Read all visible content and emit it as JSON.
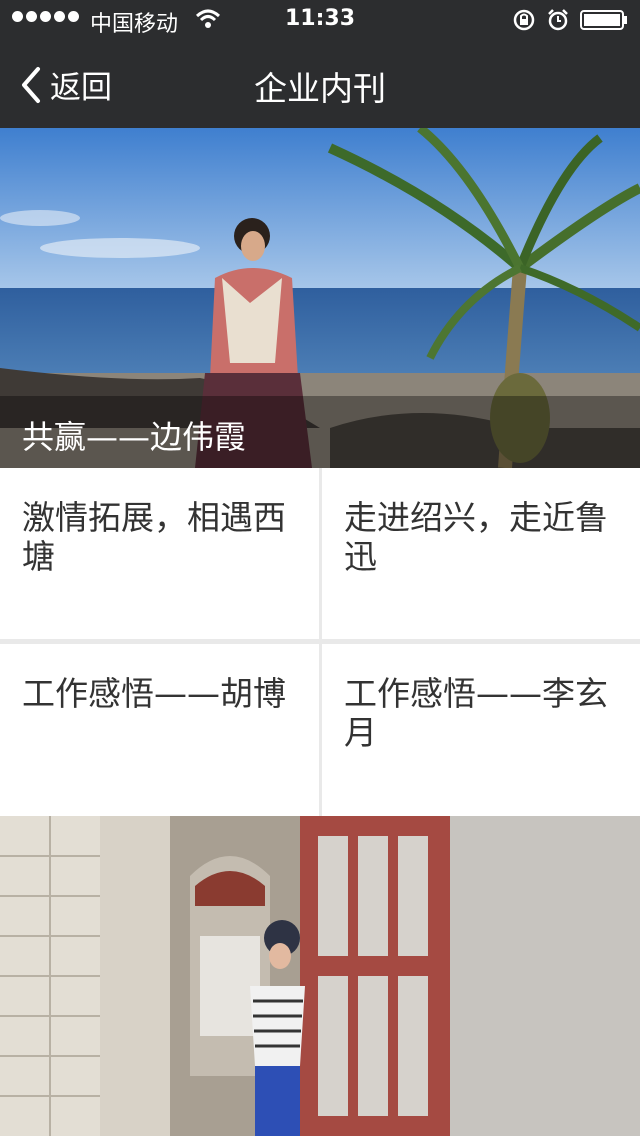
{
  "status_bar": {
    "carrier": "中国移动",
    "time": "11:33"
  },
  "nav": {
    "back_label": "返回",
    "title": "企业内刊"
  },
  "hero": {
    "caption": "共赢——边伟霞"
  },
  "tiles": [
    {
      "label": "激情拓展，相遇西塘"
    },
    {
      "label": "走进绍兴，走近鲁迅"
    },
    {
      "label": "工作感悟——胡博"
    },
    {
      "label": "工作感悟——李玄月"
    }
  ],
  "colors": {
    "nav_bg": "#2c2d2f",
    "tile_bg": "#ffffff",
    "divider": "#e9e9e9"
  }
}
